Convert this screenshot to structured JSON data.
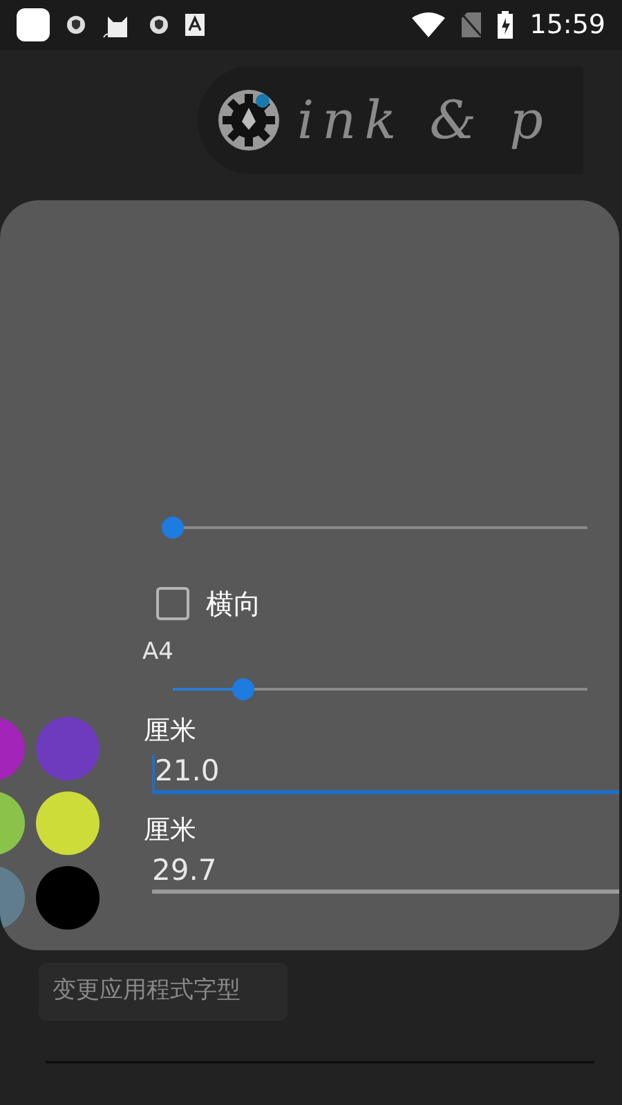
{
  "status_bar": {
    "time": "15:59"
  },
  "header": {
    "logo_text": "ink & p"
  },
  "dialog": {
    "slider_top": {
      "level": 0
    },
    "landscape": {
      "label": "横向",
      "checked": false
    },
    "paper_size": {
      "label": "A4",
      "level": 0.17
    },
    "colors": [
      {
        "color": "#a324b8"
      },
      {
        "color": "#6e3bbf"
      },
      {
        "color": "#8bc34a"
      },
      {
        "color": "#cddc39"
      },
      {
        "color": "#5f7d8c"
      },
      {
        "color": "#000000"
      }
    ],
    "fields": [
      {
        "unit": "厘米",
        "value": "21.0",
        "focused": true
      },
      {
        "unit": "厘米",
        "value": "29.7",
        "focused": false
      }
    ]
  },
  "font_button": {
    "label": "变更应用程式字型"
  }
}
